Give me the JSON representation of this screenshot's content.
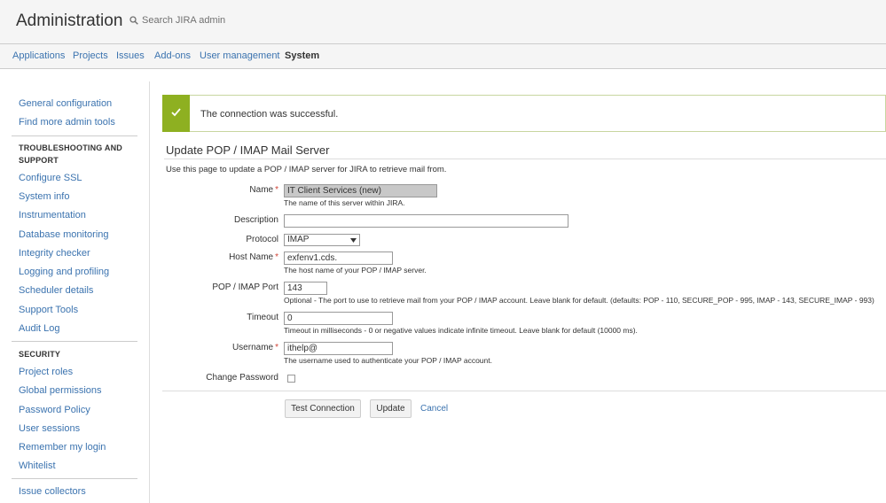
{
  "header": {
    "title": "Administration",
    "search_label": "Search JIRA admin"
  },
  "nav": {
    "tabs": [
      "Applications",
      "Projects",
      "Issues",
      "Add-ons",
      "User management",
      "System"
    ],
    "active": "System"
  },
  "sidebar": {
    "top_items": [
      "General configuration",
      "Find more admin tools"
    ],
    "section1": {
      "heading_line1": "TROUBLESHOOTING AND",
      "heading_line2": "SUPPORT",
      "items": [
        "Configure SSL",
        "System info",
        "Instrumentation",
        "Database monitoring",
        "Integrity checker",
        "Logging and profiling",
        "Scheduler details",
        "Support Tools",
        "Audit Log"
      ]
    },
    "section2": {
      "heading": "SECURITY",
      "items": [
        "Project roles",
        "Global permissions",
        "Password Policy",
        "User sessions",
        "Remember my login",
        "Whitelist"
      ]
    },
    "bottom_items": [
      "Issue collectors"
    ]
  },
  "message": {
    "text": "The connection was successful.",
    "color": "#8eb021"
  },
  "form": {
    "title": "Update POP / IMAP Mail Server",
    "description": "Use this page to update a POP / IMAP server for JIRA to retrieve mail from.",
    "name": {
      "label": "Name",
      "value": "IT Client Services (new)",
      "help": "The name of this server within JIRA."
    },
    "description_field": {
      "label": "Description",
      "value": ""
    },
    "protocol": {
      "label": "Protocol",
      "value": "IMAP"
    },
    "host": {
      "label": "Host Name",
      "value": "exfenv1.cds.",
      "help": "The host name of your POP / IMAP server."
    },
    "port": {
      "label": "POP / IMAP Port",
      "value": "143",
      "help": "Optional - The port to use to retrieve mail from your POP / IMAP account. Leave blank for default. (defaults: POP - 110, SECURE_POP - 995, IMAP - 143, SECURE_IMAP - 993)"
    },
    "timeout": {
      "label": "Timeout",
      "value": "0",
      "help": "Timeout in milliseconds - 0 or negative values indicate infinite timeout. Leave blank for default (10000 ms)."
    },
    "username": {
      "label": "Username",
      "value": "ithelp@",
      "help": "The username used to authenticate your POP / IMAP account."
    },
    "change_password": {
      "label": "Change Password",
      "checked": false
    },
    "required_marker": "*",
    "buttons": {
      "test": "Test Connection",
      "update": "Update",
      "cancel": "Cancel"
    }
  },
  "colors": {
    "link": "#3b73af",
    "required": "#d04437",
    "success": "#8eb021"
  }
}
